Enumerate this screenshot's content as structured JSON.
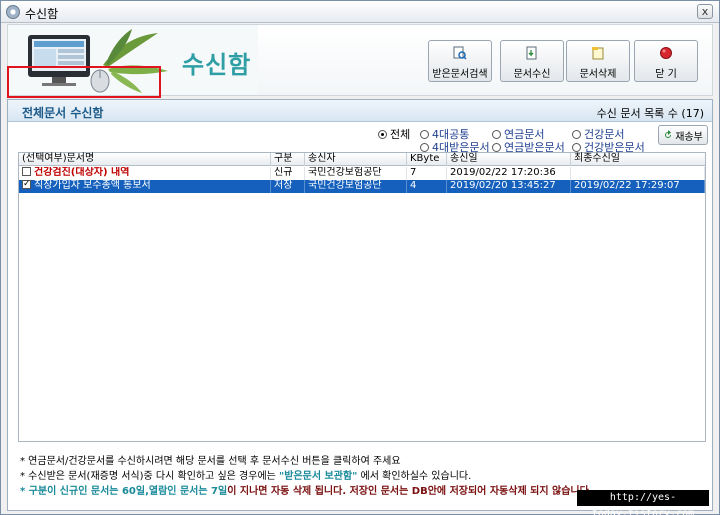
{
  "window": {
    "title": "수신함",
    "close_glyph": "x"
  },
  "banner": {
    "title": "수신함"
  },
  "toolbar": {
    "buttons": [
      {
        "label": "받은문서검색",
        "icon": "document-search-icon"
      },
      {
        "label": "문서수신",
        "icon": "document-receive-icon"
      },
      {
        "label": "문서삭제",
        "icon": "document-delete-icon"
      },
      {
        "label": "닫    기",
        "icon": "close-circle-icon"
      }
    ]
  },
  "panel": {
    "title": "전체문서 수신함",
    "count_label": "수신 문서 목록 수 (17)"
  },
  "filters": {
    "options": [
      "전체",
      "4대공통",
      "연금문서",
      "건강문서",
      "4대받은문서",
      "연금받은문서",
      "건강받은문서"
    ],
    "selected": "전체"
  },
  "refresh_button": {
    "label": "재송부"
  },
  "table": {
    "columns": [
      "(선택여부)문서명",
      "구분",
      "송신자",
      "KByte",
      "송신일",
      "최종수신일"
    ],
    "rows": [
      {
        "checked": false,
        "name": "건강검진(대상자) 내역",
        "type": "신규",
        "sender": "국민건강보험공단",
        "size": "7",
        "sent": "2019/02/22 17:20:36",
        "last_received": ""
      },
      {
        "checked": true,
        "name": "직장가입자 보수총액 통보서",
        "type": "저장",
        "sender": "국민건강보험공단",
        "size": "4",
        "sent": "2019/02/20 13:45:27",
        "last_received": "2019/02/22 17:29:07"
      }
    ]
  },
  "notes": {
    "line1": "* 연금문서/건강문서를 수신하시려면 해당 문서를 선택 후 문서수신 버튼을 클릭하여 주세요",
    "line2_a": "* 수신받은 문서(재증명 서식)중 다시 확인하고 싶은 경우에는 ",
    "line2_quote": "\"받은문서 보관함\"",
    "line2_b": " 에서 확인하실수 있습니다.",
    "line3_a": "* 구분이 신규인 문서는 60일,열람인 문서는 7일",
    "line3_b": "이 지나면 자동 삭제 됩니다. 저장인 문서는 DB안에 저장되어 자동삭제 되지 않습니다."
  },
  "watermark": "http://yes-today.tistory.com",
  "colors": {
    "accent": "#2f9fa5",
    "selection": "#1560bd",
    "highlight_box": "#e0141e",
    "new_item": "#c00000"
  }
}
